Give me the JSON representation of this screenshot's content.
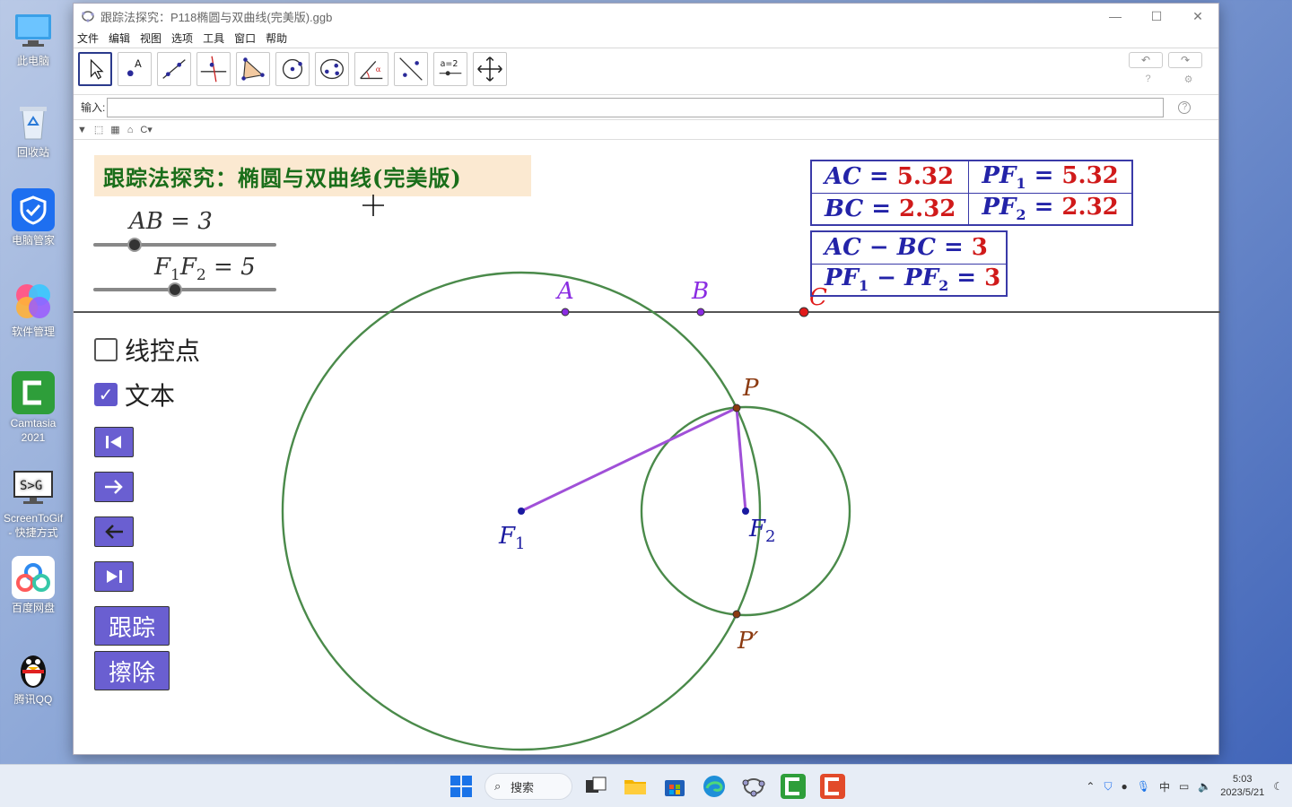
{
  "desktop": {
    "icons": [
      {
        "label": "此电脑"
      },
      {
        "label": "回收站"
      },
      {
        "label": "电脑管家"
      },
      {
        "label": "软件管理"
      },
      {
        "label": "Camtasia 2021"
      },
      {
        "label": "ScreenToGif - 快捷方式"
      },
      {
        "label": "百度网盘"
      },
      {
        "label": "腾讯QQ"
      }
    ]
  },
  "window": {
    "title": "跟踪法探究：P118椭圆与双曲线(完美版).ggb",
    "menu": [
      "文件",
      "编辑",
      "视图",
      "选项",
      "工具",
      "窗口",
      "帮助"
    ],
    "input_label": "输入:",
    "input_value": ""
  },
  "canvas": {
    "title": "跟踪法探究：椭圆与双曲线(完美版)",
    "slider1": {
      "label": "AB = 3",
      "value": 3
    },
    "slider2": {
      "label_f1": "F",
      "label_sub1": "1",
      "label_f2": "F",
      "label_sub2": "2",
      "label_rest": " = 5",
      "value": 5
    },
    "table1": {
      "r1c1_var": "AC = ",
      "r1c1_val": "5.32",
      "r1c2_var": "PF",
      "r1c2_sub": "1",
      "r1c2_eq": " = ",
      "r1c2_val": "5.32",
      "r2c1_var": "BC = ",
      "r2c1_val": "2.32",
      "r2c2_var": "PF",
      "r2c2_sub": "2",
      "r2c2_eq": " = ",
      "r2c2_val": "2.32"
    },
    "table2": {
      "r1_var": "AC − BC = ",
      "r1_val": "3",
      "r2_var_a": "PF",
      "r2_sub_a": "1",
      "r2_var_b": " − PF",
      "r2_sub_b": "2",
      "r2_eq": " = ",
      "r2_val": "3"
    },
    "checkbox_line": {
      "label": "线控点",
      "checked": false
    },
    "checkbox_text": {
      "label": "文本",
      "checked": true
    },
    "btn_trace": "跟踪",
    "btn_erase": "擦除",
    "points": {
      "A": "A",
      "B": "B",
      "C": "C",
      "P": "P",
      "P_prime": "P′",
      "F1": "F",
      "F1_sub": "1",
      "F2": "F",
      "F2_sub": "2"
    },
    "colors": {
      "circle": "#4a8a4a",
      "segment": "#a050d8",
      "point_blue": "#1a1aa0",
      "point_red": "#e01a1a",
      "label_purple": "#8a2be2",
      "label_brown": "#8b3a10"
    }
  },
  "taskbar": {
    "search_label": "搜索",
    "time": "5:03",
    "date": "2023/5/21",
    "ime": "中"
  }
}
